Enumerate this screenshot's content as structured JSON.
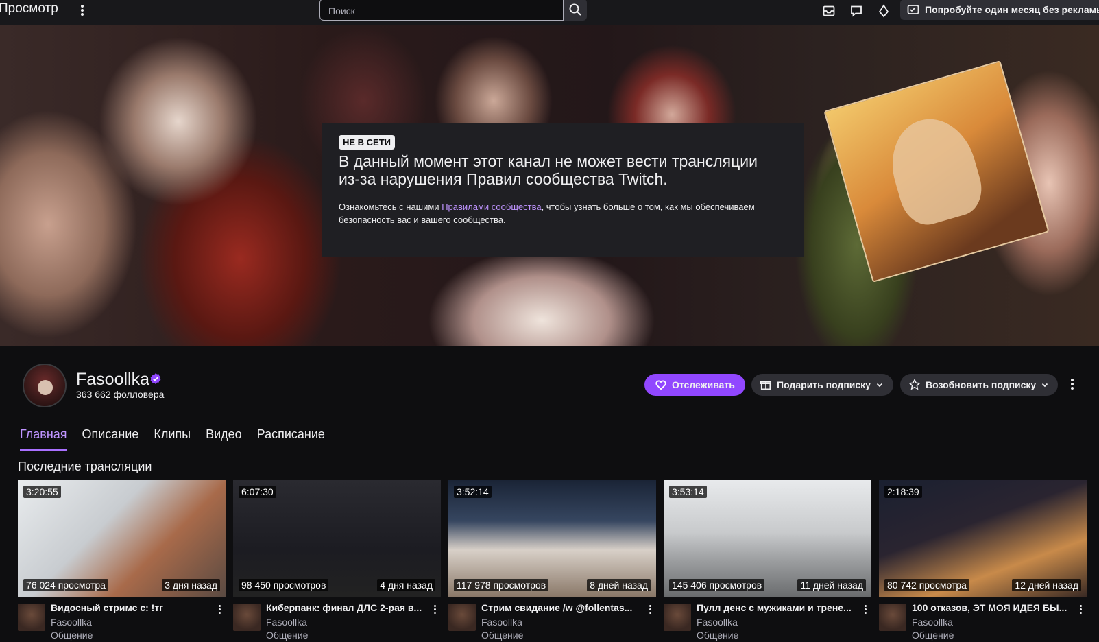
{
  "nav": {
    "browse_label": "Просмотр",
    "search_placeholder": "Поиск",
    "prime_label": "Попробуйте один месяц без рекламы"
  },
  "offline": {
    "badge": "НЕ В СЕТИ",
    "title": "В данный момент этот канал не может вести трансляции из-за нарушения Правил сообщества Twitch.",
    "text_before": "Ознакомьтесь с нашими ",
    "link": "Правилами сообщества",
    "text_after": ", чтобы узнать больше о том, как мы обеспечиваем безопасность вас и вашего сообщества."
  },
  "channel": {
    "name": "Fasoollka",
    "followers": "363 662 фолловера",
    "follow_label": "Отслеживать",
    "gift_label": "Подарить подписку",
    "resub_label": "Возобновить подписку"
  },
  "tabs": [
    "Главная",
    "Описание",
    "Клипы",
    "Видео",
    "Расписание"
  ],
  "section_title": "Последние трансляции",
  "videos": [
    {
      "duration": "3:20:55",
      "views": "76 024 просмотра",
      "ago": "3 дня назад",
      "title": "Видосный стримс с: !тг",
      "channel": "Fasoollka",
      "category": "Общение"
    },
    {
      "duration": "6:07:30",
      "views": "98 450 просмотров",
      "ago": "4 дня назад",
      "title": "Киберпанк: финал ДЛС 2-рая в...",
      "channel": "Fasoollka",
      "category": "Общение"
    },
    {
      "duration": "3:52:14",
      "views": "117 978 просмотров",
      "ago": "8 дней назад",
      "title": "Стрим свидание /w @follentas...",
      "channel": "Fasoollka",
      "category": "Общение"
    },
    {
      "duration": "3:53:14",
      "views": "145 406 просмотров",
      "ago": "11 дней назад",
      "title": "Пулл денс с мужиками и трене...",
      "channel": "Fasoollka",
      "category": "Общение"
    },
    {
      "duration": "2:18:39",
      "views": "80 742 просмотра",
      "ago": "12 дней назад",
      "title": "100 отказов, ЭТ МОЯ ИДЕЯ БЫ...",
      "channel": "Fasoollka",
      "category": "Общение"
    }
  ],
  "colors": {
    "accent": "#9147ff",
    "link": "#bf94ff",
    "bg": "#0e0e10"
  }
}
